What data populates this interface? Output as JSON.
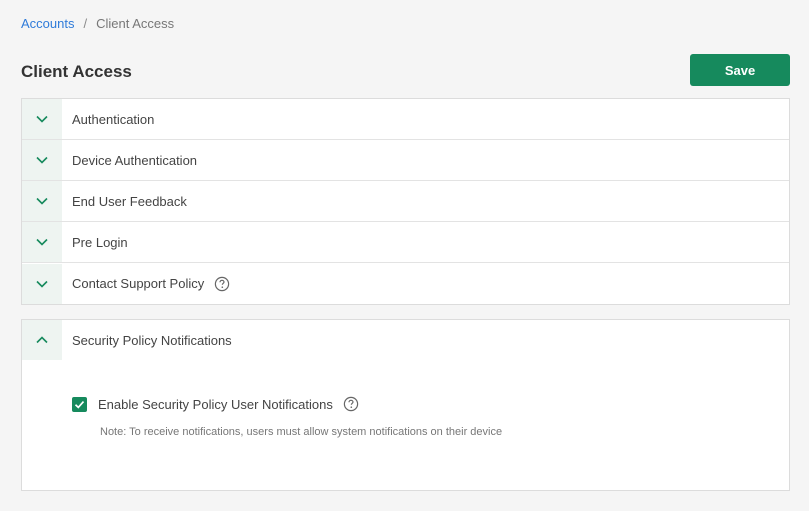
{
  "breadcrumb": {
    "parent": "Accounts",
    "separator": "/",
    "current": "Client Access"
  },
  "page": {
    "title": "Client Access",
    "save_label": "Save"
  },
  "sections": [
    {
      "label": "Authentication",
      "expanded": false,
      "has_help": false
    },
    {
      "label": "Device Authentication",
      "expanded": false,
      "has_help": false
    },
    {
      "label": "End User Feedback",
      "expanded": false,
      "has_help": false
    },
    {
      "label": "Pre Login",
      "expanded": false,
      "has_help": false
    },
    {
      "label": "Contact Support Policy",
      "expanded": false,
      "has_help": true
    }
  ],
  "notifications_panel": {
    "title": "Security Policy Notifications",
    "expanded": true,
    "checkbox_label": "Enable Security Policy User Notifications",
    "checkbox_checked": true,
    "note": "Note: To receive notifications, users must allow system notifications on their device"
  },
  "colors": {
    "accent": "#168a5d",
    "link": "#2f7bd9",
    "toggle_bg": "#eef4f1"
  },
  "icons": {
    "collapsed": "chevron-down-icon",
    "expanded": "chevron-up-icon",
    "help": "help-circle-icon",
    "check": "check-icon"
  }
}
